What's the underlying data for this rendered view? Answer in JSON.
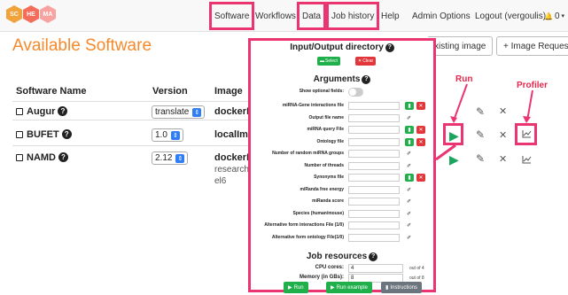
{
  "navbar": {
    "logo_letters": [
      "SC",
      "HE",
      "MA"
    ],
    "items": [
      {
        "label": "Software",
        "highlighted": true
      },
      {
        "label": "Workflows",
        "highlighted": false
      },
      {
        "label": "Data",
        "highlighted": true
      },
      {
        "label": "Job history",
        "highlighted": true
      },
      {
        "label": "Help",
        "highlighted": false
      },
      {
        "label": "Admin Options",
        "highlighted": false
      },
      {
        "label": "Logout (vergoulis)",
        "highlighted": false
      },
      {
        "label": "0",
        "highlighted": false
      }
    ],
    "highlight_color": "#ea3571"
  },
  "page": {
    "title": "Available Software",
    "title_color": "#f5892b",
    "add_existing_label": "xisting image",
    "image_request_label": "+ Image Request"
  },
  "table": {
    "headers": [
      "Software Name",
      "Version",
      "Image"
    ],
    "rows": [
      {
        "name": "Augur",
        "version": "translate",
        "image": "dockerHu",
        "image_extra": []
      },
      {
        "name": "BUFET",
        "version": "1.0",
        "image": "localImag",
        "image_extra": []
      },
      {
        "name": "NAMD",
        "version": "2.12",
        "image": "dockerHu",
        "image_extra": [
          "researchco",
          "el6"
        ]
      }
    ]
  },
  "callouts": {
    "run_label": "Run",
    "profiler_label": "Profiler"
  },
  "modal": {
    "io_title": "Input/Output directory",
    "select_label": "Select",
    "clear_label": "Clear",
    "arguments_title": "Arguments",
    "show_optional_label": "Show optional fields:",
    "arguments": [
      {
        "label": "miRNA-Gene interactions file",
        "kind": "file"
      },
      {
        "label": "Output file name",
        "kind": "wand"
      },
      {
        "label": "miRNA query File",
        "kind": "file"
      },
      {
        "label": "Ontology file",
        "kind": "file"
      },
      {
        "label": "Number of random miRNA groups",
        "kind": "wand"
      },
      {
        "label": "Number of threads",
        "kind": "wand"
      },
      {
        "label": "Synonyms file",
        "kind": "file"
      },
      {
        "label": "miRanda free energy",
        "kind": "wand"
      },
      {
        "label": "miRanda score",
        "kind": "wand"
      },
      {
        "label": "Species (human/mouse)",
        "kind": "wand"
      },
      {
        "label": "Alternative form interactions File (1/0)",
        "kind": "wand"
      },
      {
        "label": "Alternative form ontology File(1/0)",
        "kind": "wand"
      }
    ],
    "resources_title": "Job resources",
    "cpu_label": "CPU cores:",
    "cpu_value": "4",
    "cpu_out_of": "out of 4",
    "memory_label": "Memory (in GBs):",
    "memory_value": "8",
    "memory_out_of": "out of 8",
    "run_label": "Run",
    "run_example_label": "Run example",
    "instructions_label": "Instructions"
  },
  "icons": {
    "play": "▶",
    "edit": "✎",
    "delete": "✕",
    "chart": "⌇",
    "wand": "✐",
    "bell": "🔔"
  }
}
